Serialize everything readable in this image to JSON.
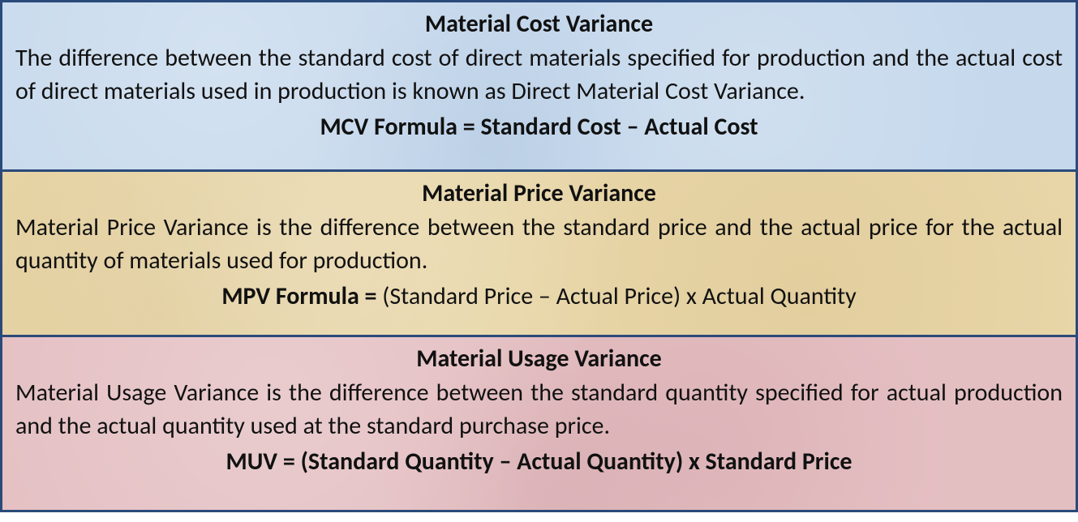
{
  "sections": [
    {
      "title": "Material Cost Variance",
      "body": "The difference between the standard cost of direct materials specified for production and the actual cost of direct materials used in production is known as Direct Material Cost Variance.",
      "formula_label": "MCV  Formula = ",
      "formula_rest": "Standard Cost – Actual Cost",
      "formula_all_bold": true
    },
    {
      "title": "Material Price Variance",
      "body": "Material Price Variance is the difference between the standard price and the actual price for the actual quantity of materials used for production.",
      "formula_label": "MPV  Formula = ",
      "formula_rest": "(Standard Price – Actual Price) x Actual Quantity",
      "formula_all_bold": false
    },
    {
      "title": "Material Usage Variance",
      "body": "Material Usage Variance is the difference between the standard quantity specified for actual production and the actual quantity used at the standard purchase price.",
      "formula_label": "MUV = ",
      "formula_rest": "(Standard Quantity – Actual Quantity) x Standard Price",
      "formula_all_bold": true
    }
  ]
}
